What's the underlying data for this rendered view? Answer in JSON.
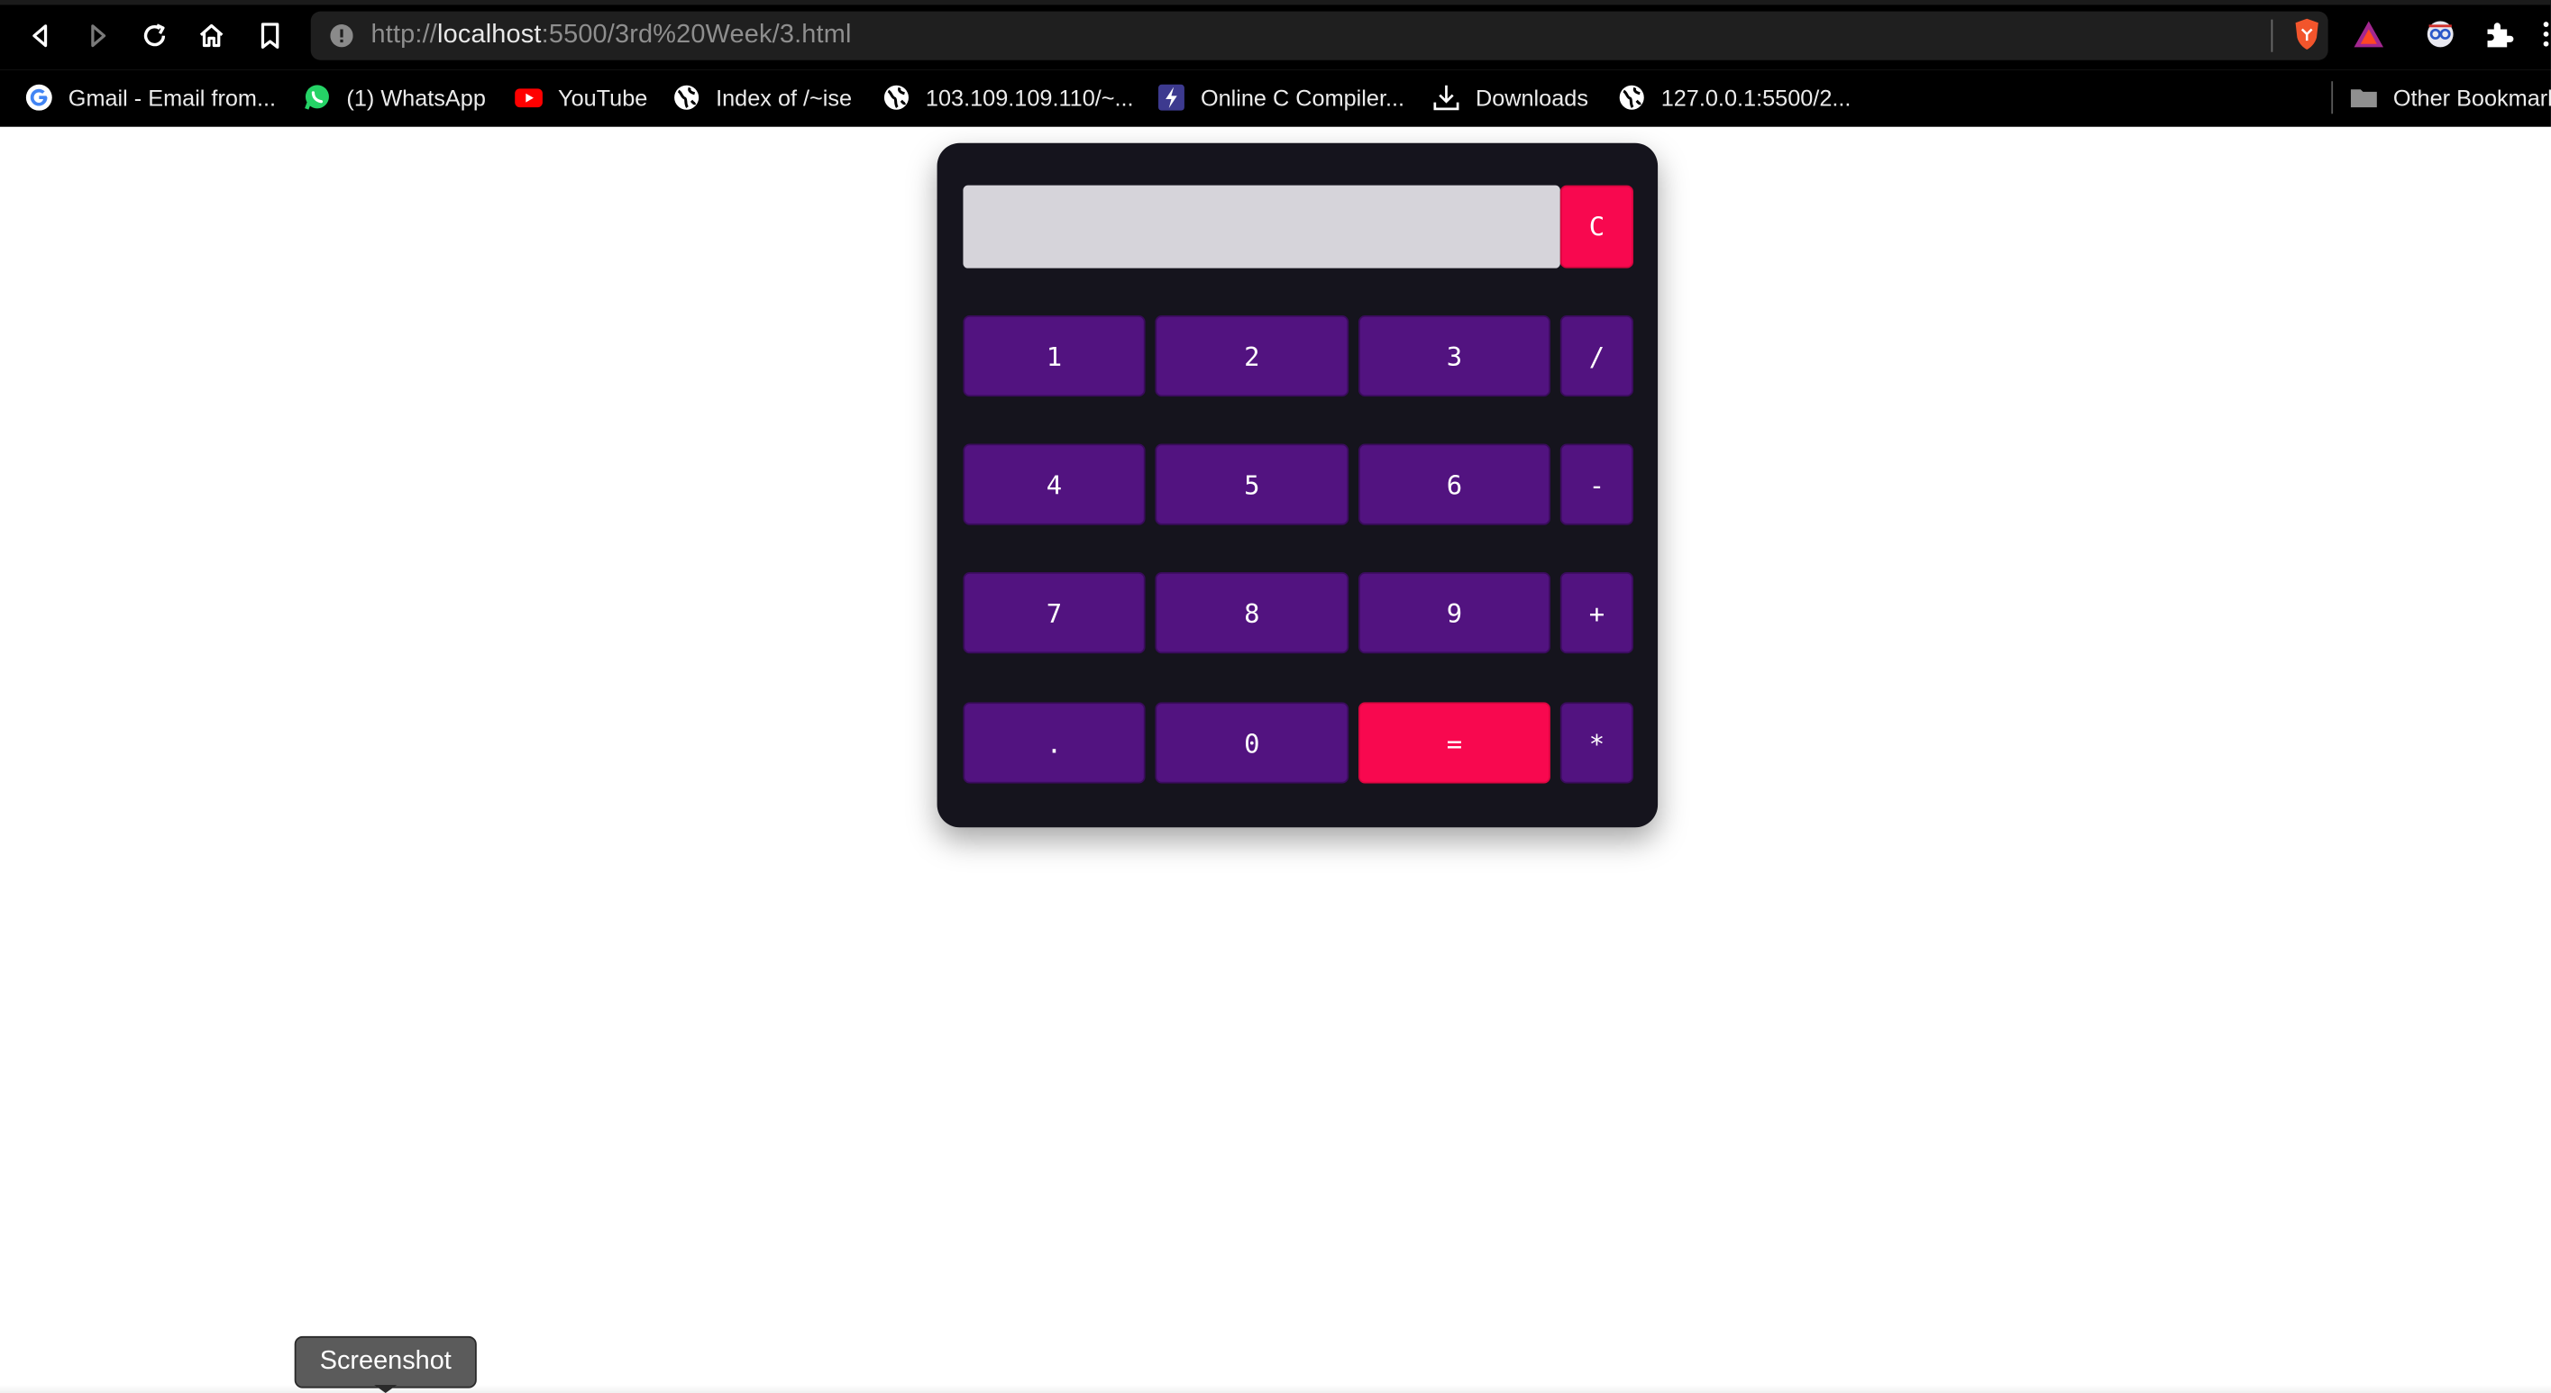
{
  "browser": {
    "url_scheme": "http://",
    "url_host": "localhost",
    "url_path": ":5500/3rd%20Week/3.html",
    "bookmarks": [
      {
        "label": "Gmail - Email from...",
        "icon": "google-icon"
      },
      {
        "label": "(1) WhatsApp",
        "icon": "whatsapp-icon"
      },
      {
        "label": "YouTube",
        "icon": "youtube-icon"
      },
      {
        "label": "Index of /~ise",
        "icon": "globe-icon"
      },
      {
        "label": "103.109.109.110/~...",
        "icon": "globe-icon"
      },
      {
        "label": "Online C Compiler...",
        "icon": "bolt-icon"
      },
      {
        "label": "Downloads",
        "icon": "download-icon"
      },
      {
        "label": "127.0.0.1:5500/2...",
        "icon": "globe-icon"
      }
    ],
    "other_bookmarks": "Other Bookmarks"
  },
  "calculator": {
    "display_value": "",
    "clear_label": "C",
    "keys": [
      {
        "label": "1",
        "name": "key-1"
      },
      {
        "label": "2",
        "name": "key-2"
      },
      {
        "label": "3",
        "name": "key-3"
      },
      {
        "label": "/",
        "name": "key-divide"
      },
      {
        "label": "4",
        "name": "key-4"
      },
      {
        "label": "5",
        "name": "key-5"
      },
      {
        "label": "6",
        "name": "key-6"
      },
      {
        "label": "-",
        "name": "key-minus"
      },
      {
        "label": "7",
        "name": "key-7"
      },
      {
        "label": "8",
        "name": "key-8"
      },
      {
        "label": "9",
        "name": "key-9"
      },
      {
        "label": "+",
        "name": "key-plus"
      },
      {
        "label": ".",
        "name": "key-decimal"
      },
      {
        "label": "0",
        "name": "key-0"
      },
      {
        "label": "=",
        "name": "key-equals"
      },
      {
        "label": "*",
        "name": "key-multiply"
      }
    ],
    "colors": {
      "panel": "#15141d",
      "key": "#521380",
      "accent": "#f8084f",
      "display": "#d6d4da"
    }
  },
  "tooltip": {
    "label": "Screenshot"
  }
}
